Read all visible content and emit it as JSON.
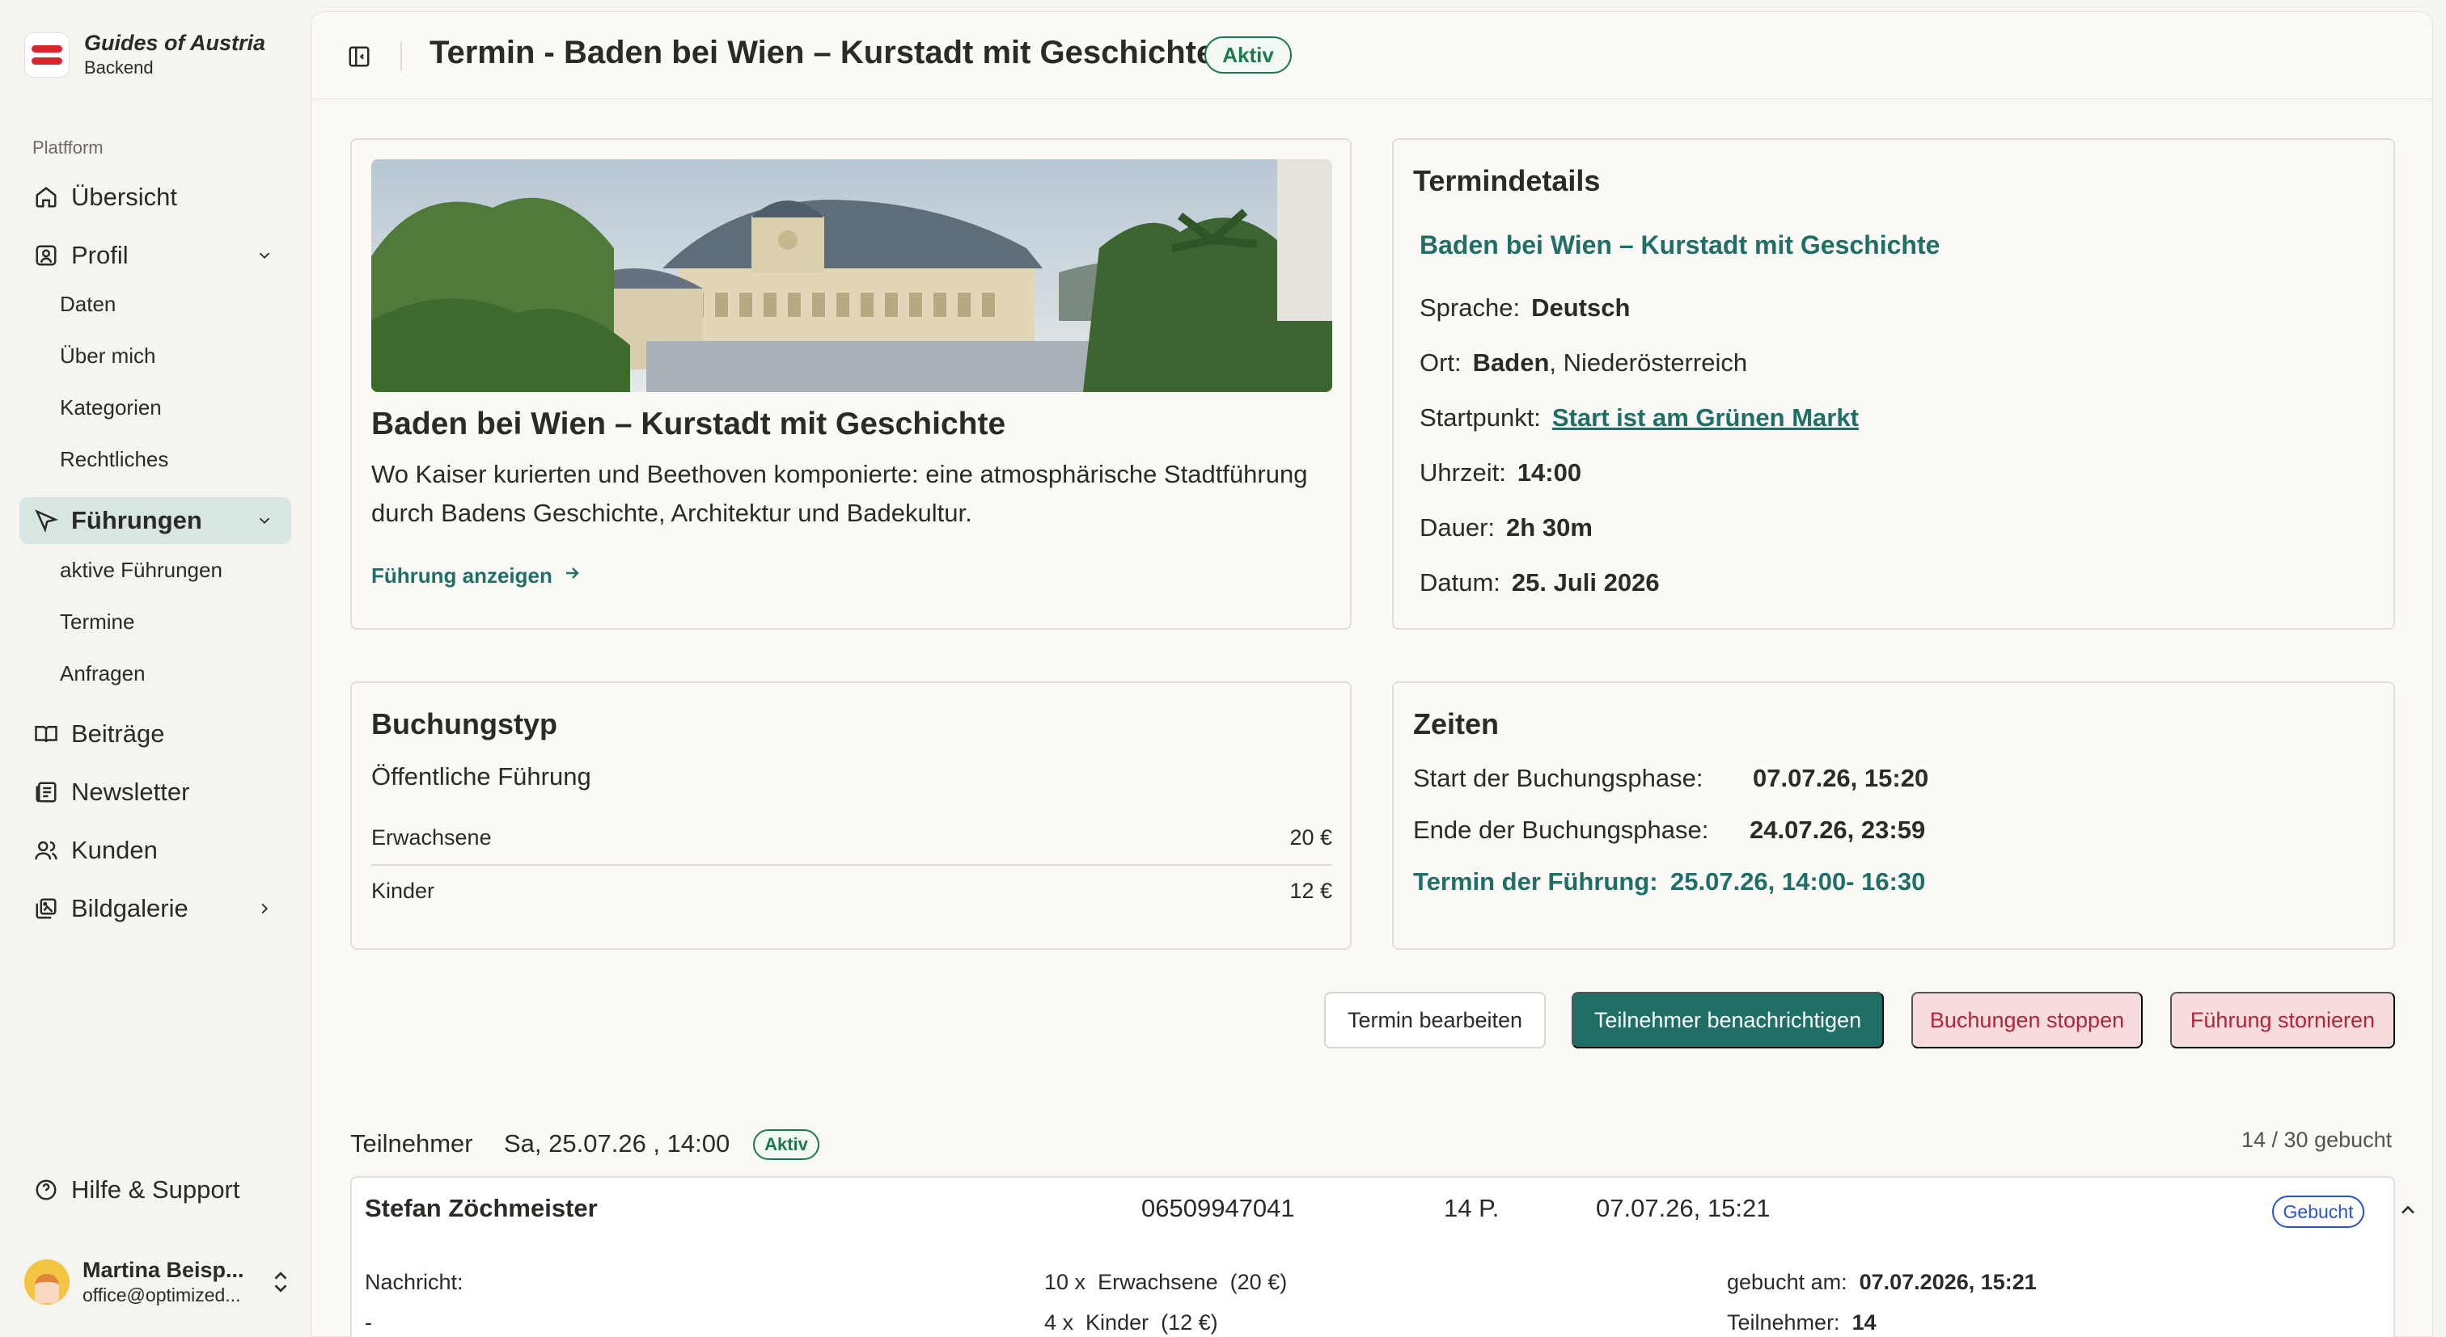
{
  "brand": {
    "title": "Guides of Austria",
    "subtitle": "Backend"
  },
  "sidebar": {
    "section_label": "Platfform",
    "items": [
      {
        "label": "Übersicht",
        "icon": "home-icon"
      },
      {
        "label": "Profil",
        "icon": "user-square-icon",
        "expanded": true,
        "children": [
          "Daten",
          "Über mich",
          "Kategorien",
          "Rechtliches"
        ]
      },
      {
        "label": "Führungen",
        "icon": "navigation-icon",
        "expanded": true,
        "active": true,
        "children": [
          "aktive Führungen",
          "Termine",
          "Anfragen"
        ]
      },
      {
        "label": "Beiträge",
        "icon": "book-icon"
      },
      {
        "label": "Newsletter",
        "icon": "newspaper-icon"
      },
      {
        "label": "Kunden",
        "icon": "users-icon"
      },
      {
        "label": "Bildgalerie",
        "icon": "image-gallery-icon"
      }
    ],
    "help": "Hilfe & Support",
    "user": {
      "name": "Martina Beisp...",
      "email": "office@optimized..."
    }
  },
  "header": {
    "title": "Termin - Baden bei Wien – Kurstadt mit Geschichte",
    "status": "Aktiv"
  },
  "tour_card": {
    "title": "Baden bei Wien – Kurstadt mit Geschichte",
    "description": "Wo Kaiser kurierten und Beethoven komponierte: eine atmosphärische Stadtführung durch Badens Geschichte, Architektur und Badekultur.",
    "link": "Führung anzeigen"
  },
  "details": {
    "heading": "Termindetails",
    "tour_name": "Baden bei Wien – Kurstadt mit Geschichte",
    "sprache_label": "Sprache:",
    "sprache": "Deutsch",
    "ort_label": "Ort:",
    "ort_city": "Baden",
    "ort_region": ", Niederösterreich",
    "startpunkt_label": "Startpunkt:",
    "startpunkt": "Start ist am Grünen Markt",
    "uhrzeit_label": "Uhrzeit:",
    "uhrzeit": "14:00",
    "dauer_label": "Dauer:",
    "dauer": "2h 30m",
    "datum_label": "Datum:",
    "datum": "25. Juli 2026"
  },
  "buchungstyp": {
    "heading": "Buchungstyp",
    "type": "Öffentliche Führung",
    "prices": [
      {
        "label": "Erwachsene",
        "price": "20 €"
      },
      {
        "label": "Kinder",
        "price": "12 €"
      }
    ]
  },
  "zeiten": {
    "heading": "Zeiten",
    "start_label": "Start der Buchungsphase:",
    "start": "07.07.26, 15:20",
    "ende_label": "Ende der Buchungsphase:",
    "ende": "24.07.26, 23:59",
    "termin_label": "Termin der Führung:",
    "termin": "25.07.26, 14:00- 16:30"
  },
  "actions": {
    "edit": "Termin bearbeiten",
    "notify": "Teilnehmer benachrichtigen",
    "stop": "Buchungen stoppen",
    "cancel": "Führung stornieren"
  },
  "participants": {
    "label": "Teilnehmer",
    "date": "Sa, 25.07.26 , 14:00",
    "status": "Aktiv",
    "count": "14 / 30 gebucht",
    "booking": {
      "name": "Stefan Zöchmeister",
      "phone": "06509947041",
      "persons": "14 P.",
      "booked": "07.07.26, 15:21",
      "status": "Gebucht",
      "nachricht_label": "Nachricht:",
      "nachricht": "-",
      "adult_qty": "10 x",
      "adult_label": "Erwachsene",
      "adult_price": "(20 €)",
      "child_qty": "4 x",
      "child_label": "Kinder",
      "child_price": "(12 €)",
      "gebucht_am_label": "gebucht am:",
      "gebucht_am": "07.07.2026, 15:21",
      "teilnehmer_label": "Teilnehmer:",
      "teilnehmer": "14"
    }
  }
}
